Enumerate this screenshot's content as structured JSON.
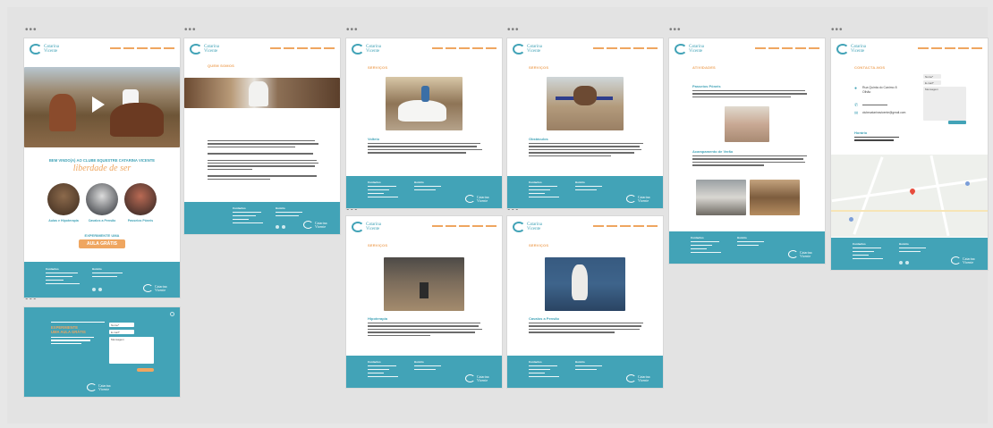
{
  "board": {
    "background": "#e3e3e3"
  },
  "colors": {
    "teal": "#42a3b7",
    "orange": "#efa660",
    "text": "#6c6c6c"
  },
  "frame_menu_icon": "ellipsis-icon",
  "brand": {
    "line1": "Catarina",
    "line2": "Vicente"
  },
  "home": {
    "welcome": "BEM VINDO(A) AO CLUBE EQUESTRE CATARINA VICENTE",
    "tagline": "liberdade de ser",
    "cards": [
      "Aulas e Hipoterapia",
      "Cavalos a Pensão",
      "Passeios Pôneis"
    ],
    "cta_heading": "EXPERIMENTE UMA",
    "cta_button": "AULA GRÁTIS"
  },
  "popup": {
    "heading_line1": "EXPERIMENTE",
    "heading_line2": "UMA AULA GRÁTIS",
    "field_name": "Nome*",
    "field_email": "E-mail*",
    "field_message": "Mensagem"
  },
  "about": {
    "title": "QUEM SOMOS"
  },
  "services": {
    "title": "SERVIÇOS"
  },
  "activities": {
    "title": "ATIVIDADES"
  },
  "contact": {
    "title": "CONTACTA-NOS",
    "address_1": "Rua Quinta do Canimo 8",
    "address_2": "Olhão",
    "email": "clubecatarinavicente@gmail.com",
    "hours_title": "Horário",
    "field_name": "Nome*",
    "field_email": "E-mail*",
    "field_message": "Mensagem"
  },
  "service_pages": [
    {
      "title": "Volteio"
    },
    {
      "title": "Obstáculos"
    },
    {
      "title": "Hipoterapia"
    },
    {
      "title": "Cavalos a Pensão"
    }
  ],
  "activity_pages": [
    {
      "title": "Passeios Pôneis"
    },
    {
      "title": "Acampamento de Verão"
    }
  ],
  "footer": {
    "col1": "Contactos",
    "col2": "Horário"
  }
}
